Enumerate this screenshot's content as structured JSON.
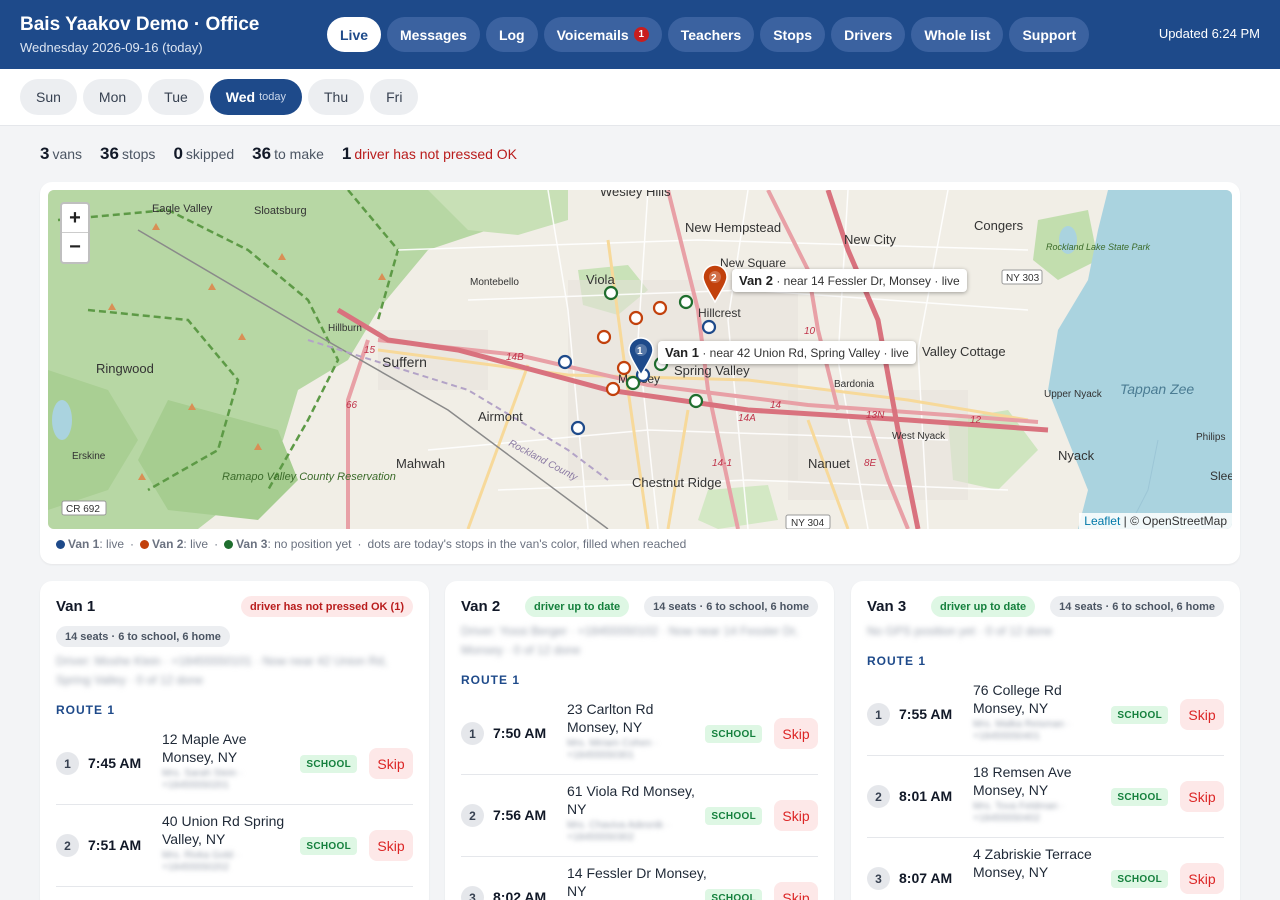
{
  "header": {
    "title": "Bais Yaakov Demo · Office",
    "date": "Wednesday 2026-09-16 (today)",
    "updated": "Updated 6:24 PM",
    "tabs": [
      {
        "label": "Live",
        "active": true
      },
      {
        "label": "Messages"
      },
      {
        "label": "Log"
      },
      {
        "label": "Voicemails",
        "badge": "1"
      },
      {
        "label": "Teachers"
      },
      {
        "label": "Stops"
      },
      {
        "label": "Drivers"
      },
      {
        "label": "Whole list"
      },
      {
        "label": "Support"
      }
    ]
  },
  "days": {
    "items": [
      "Sun",
      "Mon",
      "Tue",
      "Wed",
      "Thu",
      "Fri"
    ],
    "active": "Wed",
    "today_label": "today"
  },
  "summary": {
    "vans": "3",
    "vans_label": "vans",
    "stops": "36",
    "stops_label": "stops",
    "skipped": "0",
    "skipped_label": "skipped",
    "to_make": "36",
    "to_make_label": "to make",
    "not_ok": "1",
    "not_ok_label": "driver has not pressed OK"
  },
  "map": {
    "zoom_in": "+",
    "zoom_out": "−",
    "attribution_leaflet": "Leaflet",
    "attribution_osm": "| © OpenStreetMap",
    "places": [
      "Wesley Hills",
      "New Hempstead",
      "New City",
      "Congers",
      "Eagle Valley",
      "Sloatsburg",
      "Viola",
      "Montebello",
      "New Square",
      "Hillcrest",
      "Hillburn",
      "Suffern",
      "Ringwood",
      "Spring Valley",
      "Valley Cottage",
      "Bardonia",
      "Airmont",
      "Monsey",
      "Nanuet",
      "West Nyack",
      "Nyack",
      "Upper Nyack",
      "Tappan Zee",
      "Mahwah",
      "Chestnut Ridge",
      "Erskine",
      "Ramapo Valley County Reservation",
      "Rockland Lake State Park",
      "Philips",
      "Slee"
    ],
    "road_labels": [
      "NY 303",
      "CR 692",
      "NY 304",
      "14B",
      "14A",
      "14",
      "13N",
      "12",
      "8E",
      "10",
      "15",
      "66",
      "14-1",
      "Rockland County"
    ],
    "van1_label": "Van 1",
    "van1_detail": "· near 42 Union Rd, Spring Valley · live",
    "van2_label": "Van 2",
    "van2_detail": "· near 14 Fessler Dr, Monsey · live"
  },
  "legend": {
    "van1": "Van 1",
    "van1_status": ": live",
    "van2": "Van 2",
    "van2_status": ": live",
    "van3": "Van 3",
    "van3_status": ": no position yet",
    "note": "dots are today's stops in the van's color, filled when reached",
    "sep": "·"
  },
  "colors": {
    "van1": "#1e4a8a",
    "van2": "#c2410c",
    "van3": "#1f6e2e"
  },
  "vans": [
    {
      "name": "Van 1",
      "status": "driver has not pressed OK (1)",
      "seats": "14 seats · 6 to school, 6 home",
      "driver_info": "Driver: Moshe Klein · +18455550101 · Now near 42 Union Rd, Spring Valley · 0 of 12 done",
      "route": "ROUTE 1",
      "stops": [
        {
          "num": "1",
          "time": "7:45 AM",
          "address": "12 Maple Ave Monsey, NY",
          "contact": "Mrs. Sarah Stein · +18455550201",
          "tag": "SCHOOL",
          "action": "Skip"
        },
        {
          "num": "2",
          "time": "7:51 AM",
          "address": "40 Union Rd Spring Valley, NY",
          "contact": "Mrs. Rivka Gold · +18455550202",
          "tag": "SCHOOL",
          "action": "Skip"
        }
      ]
    },
    {
      "name": "Van 2",
      "status": "driver up to date",
      "seats": "14 seats · 6 to school, 6 home",
      "driver_info": "Driver: Yossi Berger · +18455550102 · Now near 14 Fessler Dr, Monsey · 0 of 12 done",
      "route": "ROUTE 1",
      "stops": [
        {
          "num": "1",
          "time": "7:50 AM",
          "address": "23 Carlton Rd Monsey, NY",
          "contact": "Mrs. Miriam Cohen · +18455550301",
          "tag": "SCHOOL",
          "action": "Skip"
        },
        {
          "num": "2",
          "time": "7:56 AM",
          "address": "61 Viola Rd Monsey, NY",
          "contact": "Mrs. Chaviva Adesnik · +18455550302",
          "tag": "SCHOOL",
          "action": "Skip"
        },
        {
          "num": "3",
          "time": "8:02 AM",
          "address": "14 Fessler Dr Monsey, NY",
          "contact": "",
          "tag": "SCHOOL",
          "action": "Skip"
        }
      ]
    },
    {
      "name": "Van 3",
      "status": "driver up to date",
      "seats": "14 seats · 6 to school, 6 home",
      "driver_info": "No GPS position yet · 0 of 12 done",
      "route": "ROUTE 1",
      "stops": [
        {
          "num": "1",
          "time": "7:55 AM",
          "address": "76 College Rd Monsey, NY",
          "contact": "Mrs. Malka Reisman · +18455550401",
          "tag": "SCHOOL",
          "action": "Skip"
        },
        {
          "num": "2",
          "time": "8:01 AM",
          "address": "18 Remsen Ave Monsey, NY",
          "contact": "Mrs. Tova Feldman · +18455550402",
          "tag": "SCHOOL",
          "action": "Skip"
        },
        {
          "num": "3",
          "time": "8:07 AM",
          "address": "4 Zabriskie Terrace Monsey, NY",
          "contact": "",
          "tag": "SCHOOL",
          "action": "Skip"
        }
      ]
    }
  ]
}
